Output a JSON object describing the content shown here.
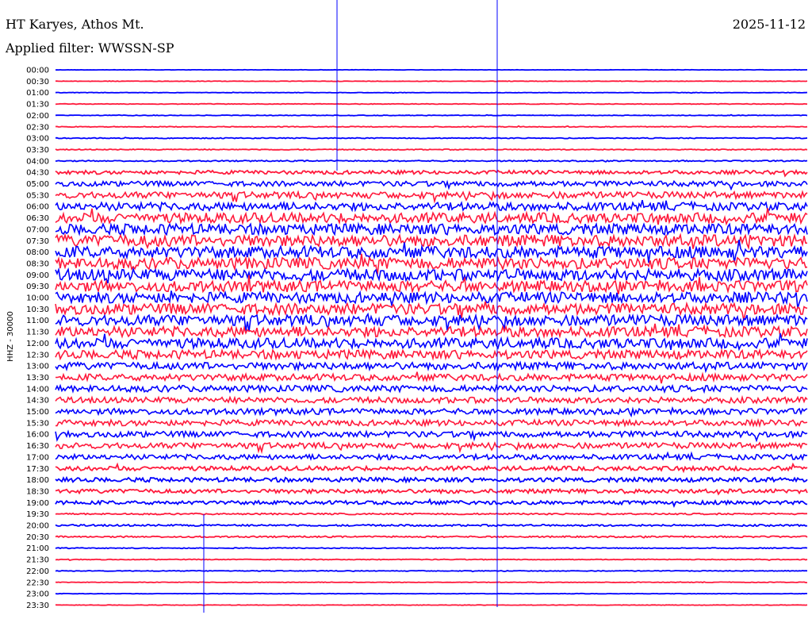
{
  "header": {
    "station": "HT Karyes, Athos Mt.",
    "date": "2025-11-12",
    "filter_label": "Applied filter: WWSSN-SP"
  },
  "chart_data": {
    "type": "line",
    "title": "HT Karyes, Athos Mt.",
    "ylabel": "HHZ - 30000",
    "xlabel": "",
    "row_labels": [
      "00:00",
      "00:30",
      "01:00",
      "01:30",
      "02:00",
      "02:30",
      "03:00",
      "03:30",
      "04:00",
      "04:30",
      "05:00",
      "05:30",
      "06:00",
      "06:30",
      "07:00",
      "07:30",
      "08:00",
      "08:30",
      "09:00",
      "09:30",
      "10:00",
      "10:30",
      "11:00",
      "11:30",
      "12:00",
      "12:30",
      "13:00",
      "13:30",
      "14:00",
      "14:30",
      "15:00",
      "15:30",
      "16:00",
      "16:30",
      "17:00",
      "17:30",
      "18:00",
      "18:30",
      "19:00",
      "19:30",
      "20:00",
      "20:30",
      "21:00",
      "21:30",
      "22:00",
      "22:30",
      "23:00",
      "23:30"
    ],
    "row_noise_level": [
      0.02,
      0.03,
      0.03,
      0.04,
      0.04,
      0.05,
      0.06,
      0.06,
      0.08,
      0.25,
      0.35,
      0.45,
      0.55,
      0.7,
      0.75,
      0.8,
      0.8,
      0.8,
      0.8,
      0.75,
      0.75,
      0.75,
      0.75,
      0.7,
      0.7,
      0.6,
      0.5,
      0.45,
      0.45,
      0.4,
      0.4,
      0.4,
      0.4,
      0.4,
      0.35,
      0.3,
      0.3,
      0.28,
      0.25,
      0.1,
      0.12,
      0.1,
      0.06,
      0.05,
      0.05,
      0.04,
      0.03,
      0.03
    ],
    "trace_colors": [
      "#0000ff",
      "#ff1a3c"
    ],
    "grid": false,
    "legend": "none"
  }
}
